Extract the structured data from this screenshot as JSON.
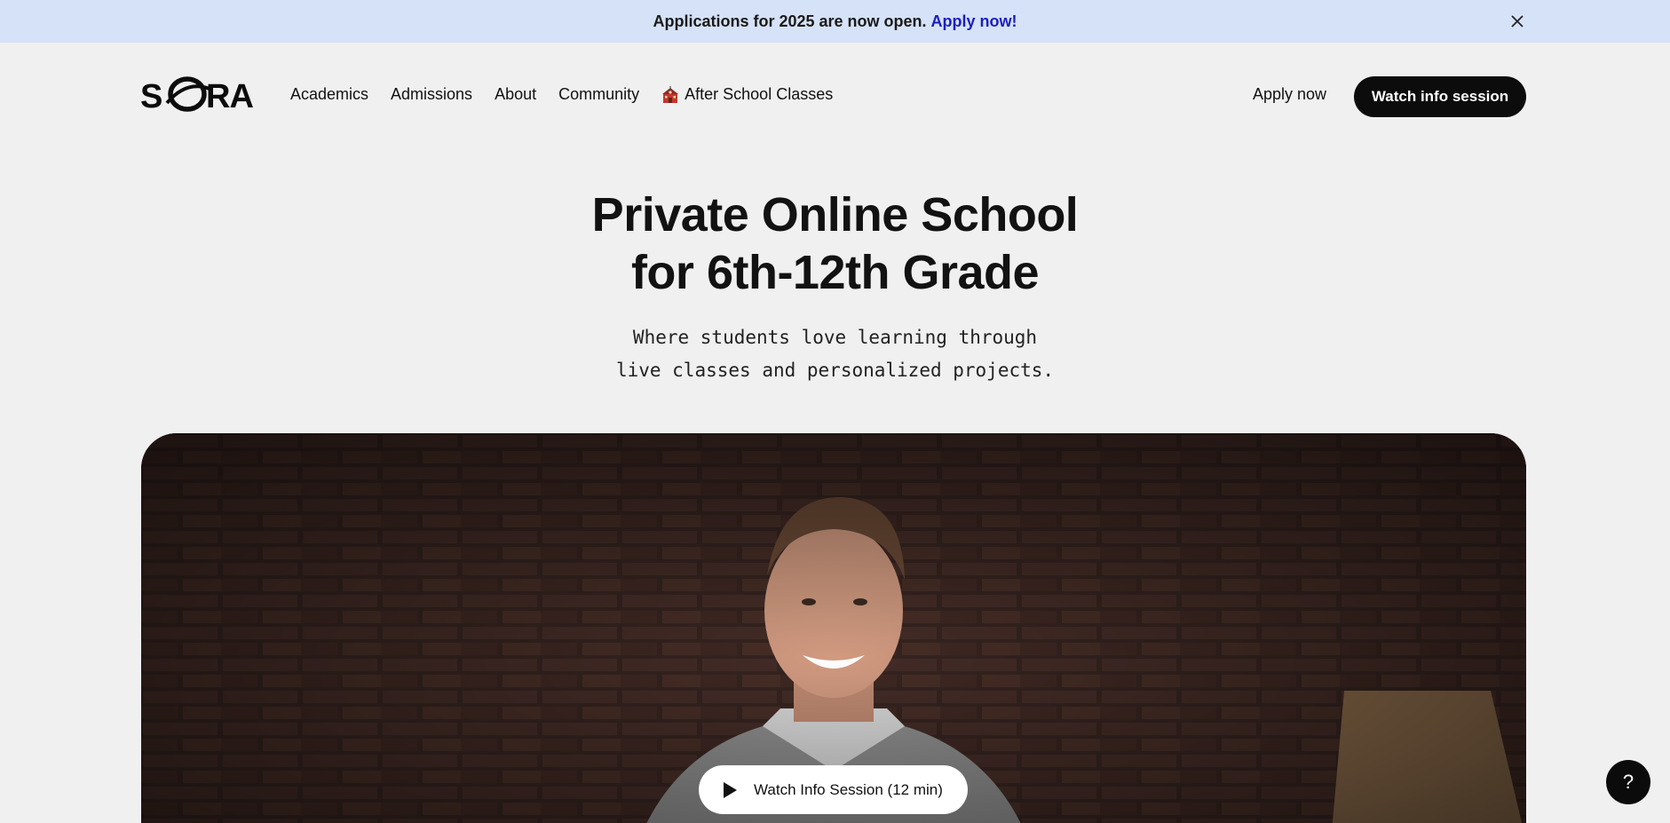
{
  "announcement": {
    "text": "Applications for 2025 are now open.",
    "link_label": "Apply now!",
    "close_icon": "close-icon"
  },
  "header": {
    "logo_text": "SORA",
    "nav": [
      {
        "label": "Academics"
      },
      {
        "label": "Admissions"
      },
      {
        "label": "About"
      },
      {
        "label": "Community"
      },
      {
        "label": "After School Classes",
        "icon": "school-building-icon"
      }
    ],
    "apply_label": "Apply now",
    "watch_label": "Watch info session"
  },
  "hero": {
    "title_line1": "Private Online School",
    "title_line2": "for 6th-12th Grade",
    "subtitle_line1": "Where students love learning through",
    "subtitle_line2": "live classes and personalized projects."
  },
  "video": {
    "play_label": "Watch Info Session (12 min)",
    "play_icon": "play-icon"
  },
  "help": {
    "label": "?"
  },
  "colors": {
    "announcement_bg": "#d5e2f7",
    "announcement_link": "#1d1dbf",
    "page_bg": "#eff0ef",
    "primary_button": "#0c0c0c"
  }
}
